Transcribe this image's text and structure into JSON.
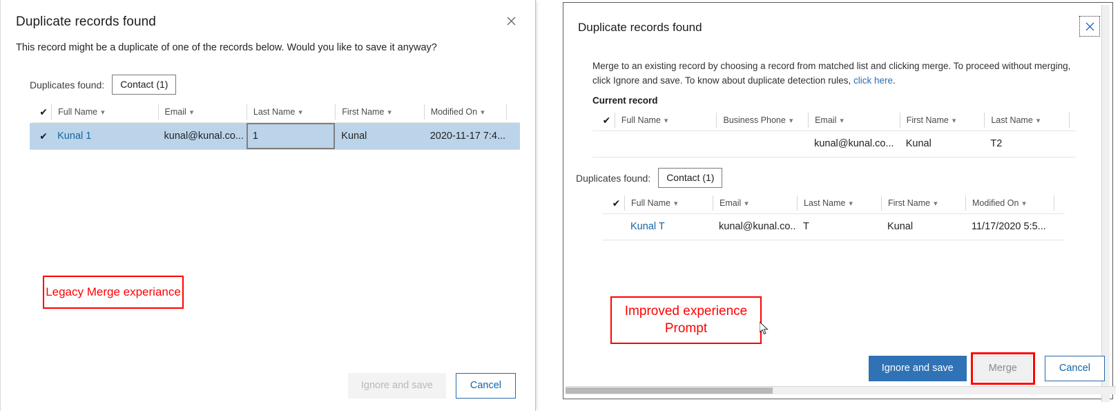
{
  "legacy": {
    "title": "Duplicate records found",
    "close_icon": "close-icon",
    "subtitle": "This record might be a duplicate of one of the records below. Would you like to save it anyway?",
    "duplicates_label": "Duplicates found:",
    "entity_chip": "Contact (1)",
    "grid": {
      "check_icon": "✔",
      "columns": [
        "Full Name",
        "Email",
        "Last Name",
        "First Name",
        "Modified On"
      ],
      "rows": [
        {
          "selected": true,
          "check": "✔",
          "full_name": "Kunal 1",
          "email": "kunal@kunal.co...",
          "last_name": "1",
          "first_name": "Kunal",
          "modified_on": "2020-11-17 7:4..."
        }
      ]
    },
    "buttons": {
      "ignore_and_save": "Ignore and save",
      "cancel": "Cancel"
    }
  },
  "improved": {
    "title": "Duplicate records found",
    "close_icon": "close-icon",
    "body_part1": "Merge to an existing record by choosing a record from matched list and clicking merge. To proceed without merging, click Ignore and save. To know about duplicate detection rules, ",
    "body_link": "click here",
    "body_part2": ".",
    "current_record_label": "Current record",
    "current_grid": {
      "check_icon": "✔",
      "columns": [
        "Full Name",
        "Business Phone",
        "Email",
        "First Name",
        "Last Name"
      ],
      "rows": [
        {
          "full_name": "",
          "business_phone": "",
          "email": "kunal@kunal.co...",
          "first_name": "Kunal",
          "last_name": "T2"
        }
      ]
    },
    "duplicates_label": "Duplicates found:",
    "entity_chip": "Contact (1)",
    "dup_grid": {
      "check_icon": "✔",
      "columns": [
        "Full Name",
        "Email",
        "Last Name",
        "First Name",
        "Modified On"
      ],
      "rows": [
        {
          "full_name": "Kunal T",
          "email": "kunal@kunal.co...",
          "last_name": "T",
          "first_name": "Kunal",
          "modified_on": "11/17/2020 5:5..."
        }
      ]
    },
    "buttons": {
      "ignore_and_save": "Ignore and save",
      "merge": "Merge",
      "cancel": "Cancel"
    }
  },
  "annotations": {
    "legacy_note": "Legacy Merge experiance",
    "improved_note": "Improved experience Prompt",
    "color": "#ff0000"
  },
  "colors": {
    "primary_button": "#2f72b5",
    "link": "#1264a3",
    "selected_row": "#bcd4ea",
    "annotation_red": "#ff0000"
  }
}
